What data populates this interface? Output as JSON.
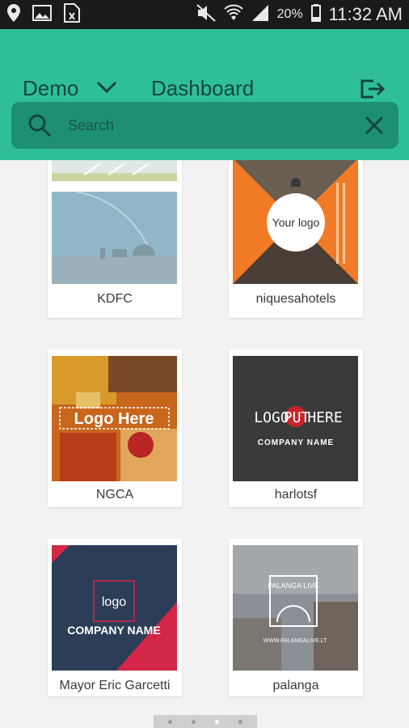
{
  "status_bar": {
    "battery": "20%",
    "time": "11:32 AM"
  },
  "header": {
    "account": "Demo",
    "dashboard": "Dashboard"
  },
  "search": {
    "placeholder": "Search"
  },
  "cards": [
    {
      "name": "KDFC"
    },
    {
      "name": "niquesahotels",
      "logo_text": "Your logo"
    },
    {
      "name": "NGCA",
      "logo_text": "Logo Here"
    },
    {
      "name": "harlotsf",
      "logo_line1a": "LOGO",
      "logo_line1b": "PUT",
      "logo_line1c": "HERE",
      "logo_line2": "COMPANY NAME"
    },
    {
      "name": "Mayor Eric Garcetti",
      "logo_text": "logo",
      "company": "COMPANY NAME"
    },
    {
      "name": "palanga",
      "logo_text": "PALANGA LIVE",
      "url": "WWW.PALANGALIVE.LT"
    }
  ],
  "pager": {
    "pages": 4,
    "active": 3
  },
  "colors": {
    "header": "#2fbf98",
    "search_bg": "#1e8f73",
    "text_dark": "#14463b"
  }
}
